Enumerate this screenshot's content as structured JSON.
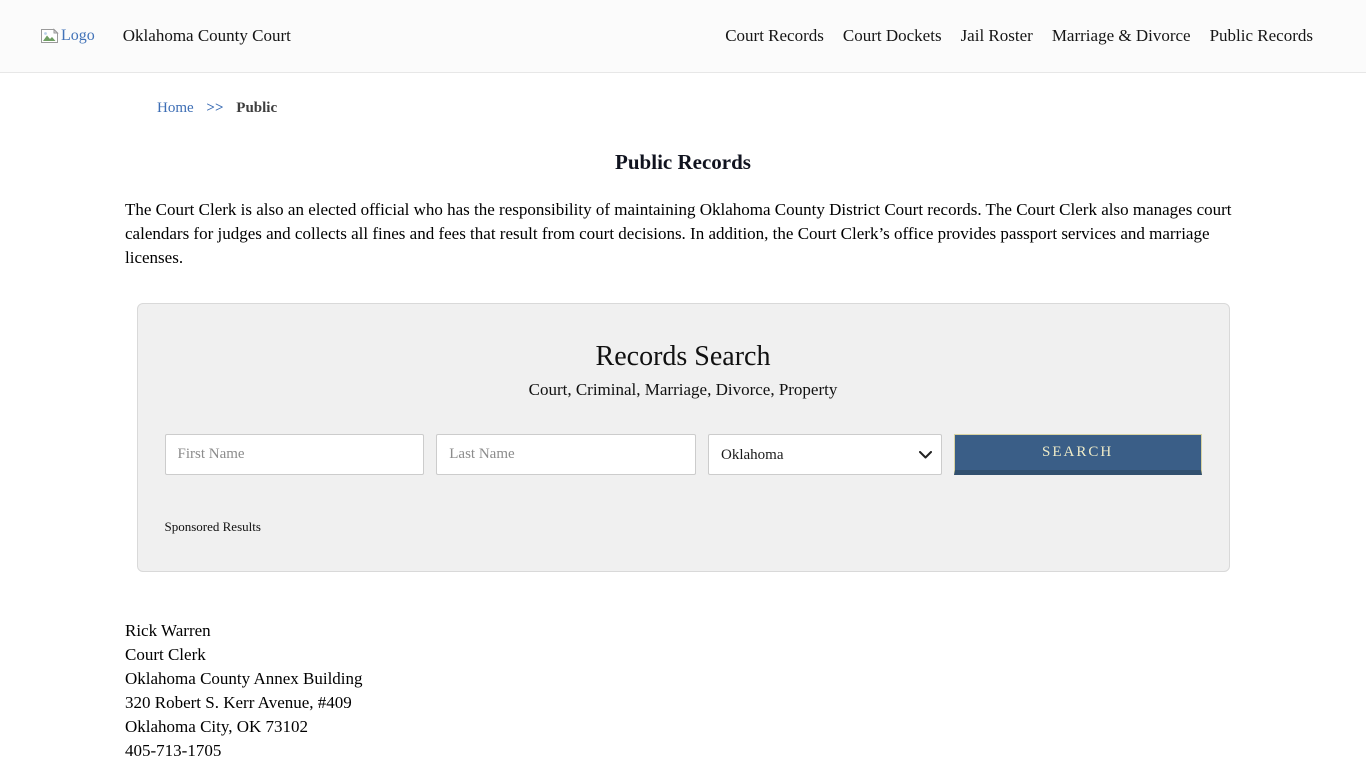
{
  "header": {
    "logo_alt": "Logo",
    "site_title": "Oklahoma County Court",
    "nav": [
      {
        "label": "Court Records"
      },
      {
        "label": "Court Dockets"
      },
      {
        "label": "Jail Roster"
      },
      {
        "label": "Marriage & Divorce"
      },
      {
        "label": "Public Records"
      }
    ]
  },
  "breadcrumb": {
    "home": "Home",
    "separator": ">>",
    "current": "Public"
  },
  "page": {
    "title": "Public Records",
    "intro": "The Court Clerk is also an elected official who has the responsibility of maintaining Oklahoma County District Court records. The Court Clerk also manages court calendars for judges and collects all fines and fees that result from court decisions. In addition, the Court Clerk’s office provides passport services and marriage licenses."
  },
  "search_panel": {
    "title": "Records Search",
    "subtitle": "Court, Criminal, Marriage, Divorce, Property",
    "first_name_placeholder": "First Name",
    "last_name_placeholder": "Last Name",
    "state_selected": "Oklahoma",
    "search_button": "SEARCH",
    "sponsored_label": "Sponsored Results"
  },
  "contact": {
    "lines": [
      "Rick Warren",
      "Court Clerk",
      "Oklahoma County Annex Building",
      "320 Robert S. Kerr Avenue, #409",
      "Oklahoma City, OK 73102",
      "405-713-1705"
    ]
  },
  "colors": {
    "accent_blue": "#3a5e87",
    "accent_blue_dark": "#31506f",
    "link_blue": "#3d6eb5",
    "button_text": "#eeebc8",
    "panel_bg": "#f0f0f0"
  }
}
